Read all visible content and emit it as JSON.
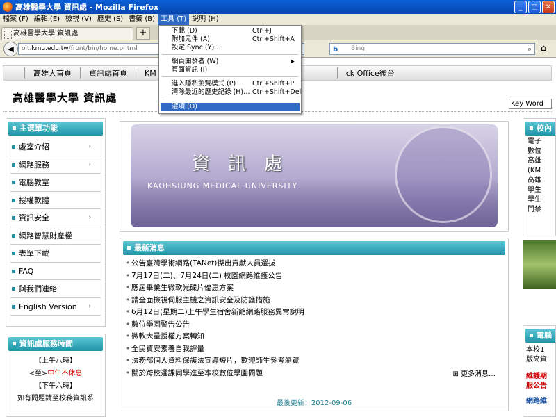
{
  "window": {
    "title": "高雄醫學大學 資訊處 - Mozilla Firefox"
  },
  "menubar": {
    "items": [
      "檔案 (F)",
      "編輯 (E)",
      "檢視 (V)",
      "歷史 (S)",
      "書籤 (B)",
      "工具 (T)",
      "說明 (H)"
    ]
  },
  "tab": {
    "title": "高雄醫學大學 資訊處",
    "newtab": "+"
  },
  "nav": {
    "url_prefix": "oit.",
    "url_host": "kmu.edu.tw",
    "url_path": "/front/bin/home.phtml",
    "search_placeholder": "Bing",
    "search_engine": "b"
  },
  "tools_menu": {
    "items": [
      {
        "label": "下載 (D)",
        "shortcut": "Ctrl+J"
      },
      {
        "label": "附加元件 (A)",
        "shortcut": "Ctrl+Shift+A"
      },
      {
        "label": "設定 Sync (Y)…",
        "shortcut": ""
      },
      {
        "label": "網頁開發者 (W)",
        "shortcut": "▸"
      },
      {
        "label": "頁面資訊 (I)",
        "shortcut": ""
      },
      {
        "label": "進入隱私瀏覽模式 (P)",
        "shortcut": "Ctrl+Shift+P"
      },
      {
        "label": "清除最近的歷史記錄 (H)…",
        "shortcut": "Ctrl+Shift+Del"
      },
      {
        "label": "選項 (O)",
        "shortcut": ""
      }
    ]
  },
  "topnav": {
    "items": [
      "高雄大首頁",
      "資訊處首頁",
      "KM",
      "ck Office後台"
    ]
  },
  "site": {
    "title": "高雄醫學大學 資訊處",
    "keyword_button": "Key Word"
  },
  "left_menu": {
    "heading": "主選單功能",
    "items": [
      {
        "label": "處室介紹",
        "arrow": "›"
      },
      {
        "label": "網路服務",
        "arrow": "›"
      },
      {
        "label": "電腦教室",
        "arrow": ""
      },
      {
        "label": "授權軟體",
        "arrow": ""
      },
      {
        "label": "資訊安全",
        "arrow": "›"
      },
      {
        "label": "網路智慧財產權",
        "arrow": ""
      },
      {
        "label": "表單下載",
        "arrow": ""
      },
      {
        "label": "FAQ",
        "arrow": ""
      },
      {
        "label": "與我們連絡",
        "arrow": ""
      },
      {
        "label": "English Version",
        "arrow": "›"
      }
    ]
  },
  "hours": {
    "heading": "資訊處服務時間",
    "line1": "【上午八時】",
    "line2_a": "<至>",
    "line2_b": "中午不休息",
    "line3": "【下午六時】",
    "line4": "如有問題請至校務資訊系"
  },
  "banner": {
    "title": "資訊處",
    "subtitle": "KAOHSIUNG MEDICAL UNIVERSITY"
  },
  "news": {
    "heading": "最新消息",
    "items": [
      "公告臺灣學術網路(TANet)傑出貢獻人員選拔",
      "7月17日(二)、7月24日(二) 校園網路維護公告",
      "應屆畢業生微軟光碟片優惠方案",
      "請全面檢視伺服主機之資訊安全及防護措施",
      "6月12日(星期二)上午學生宿舍新館網路服務異常說明",
      "數位學園警告公告",
      "微軟大量授權方案轉知",
      "全民資安素養自我評量",
      "法務部個人資料保護法宣導短片，歡迎師生參考瀏覽",
      "關於跨校選課同學進至本校數位學園問題"
    ],
    "more": "更多消息…",
    "updated": "最後更新：2012-09-06"
  },
  "right": {
    "heading": "校內",
    "items": [
      "電子",
      "數位",
      "高雄",
      "(KM",
      "高雄",
      "學生",
      "學生",
      "門禁"
    ],
    "heading2": "電腦",
    "text2": [
      "本校1",
      "版高資"
    ],
    "text3": [
      "維護期",
      "服公告"
    ],
    "text4": "網路維"
  }
}
